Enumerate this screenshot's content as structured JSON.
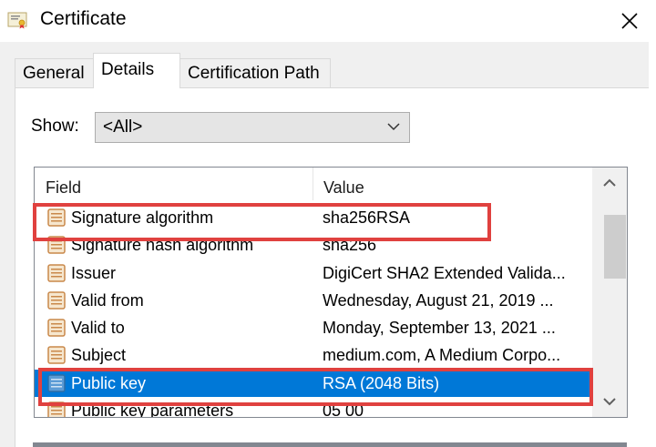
{
  "window": {
    "title": "Certificate",
    "icon": "certificate-icon",
    "close_icon": "close-icon"
  },
  "tabs": [
    {
      "label": "General",
      "active": false
    },
    {
      "label": "Details",
      "active": true
    },
    {
      "label": "Certification Path",
      "active": false
    }
  ],
  "show": {
    "label": "Show:",
    "selected": "<All>"
  },
  "list": {
    "headers": {
      "field": "Field",
      "value": "Value"
    },
    "rows": [
      {
        "field": "Signature algorithm",
        "value": "sha256RSA",
        "selected": false
      },
      {
        "field": "Signature hash algorithm",
        "value": "sha256",
        "selected": false
      },
      {
        "field": "Issuer",
        "value": "DigiCert SHA2 Extended Valida...",
        "selected": false
      },
      {
        "field": "Valid from",
        "value": "Wednesday, August 21, 2019 ...",
        "selected": false
      },
      {
        "field": "Valid to",
        "value": "Monday, September 13, 2021 ...",
        "selected": false
      },
      {
        "field": "Subject",
        "value": "medium.com, A Medium Corpo...",
        "selected": false
      },
      {
        "field": "Public key",
        "value": "RSA (2048 Bits)",
        "selected": true
      },
      {
        "field": "Public key parameters",
        "value": "05 00",
        "selected": false
      }
    ]
  },
  "colors": {
    "selection": "#0078d7",
    "highlight_box": "#e0413f"
  }
}
